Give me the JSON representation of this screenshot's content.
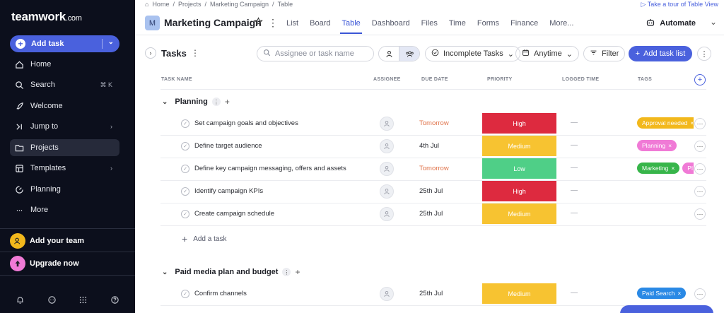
{
  "sidebar": {
    "logo": "teamwork",
    "logo_suffix": ".com",
    "add_task": "Add task",
    "items": [
      {
        "label": "Home",
        "icon": "home-icon"
      },
      {
        "label": "Search",
        "icon": "search-icon",
        "shortcut": "⌘ K"
      },
      {
        "label": "Welcome",
        "icon": "rocket-icon"
      },
      {
        "label": "Jump to",
        "icon": "jump-icon",
        "chevron": "›"
      },
      {
        "label": "Projects",
        "icon": "folder-icon",
        "active": true
      },
      {
        "label": "Templates",
        "icon": "templates-icon",
        "chevron": "›"
      },
      {
        "label": "Planning",
        "icon": "planning-icon"
      },
      {
        "label": "More",
        "icon": "more-icon"
      }
    ],
    "add_team": "Add your team",
    "upgrade": "Upgrade now"
  },
  "header": {
    "breadcrumbs": [
      "Home",
      "Projects",
      "Marketing Campaign",
      "Table"
    ],
    "tour": "Take a tour of Table View",
    "project_initial": "M",
    "project_title": "Marketing Campaign",
    "tabs": [
      "List",
      "Board",
      "Table",
      "Dashboard",
      "Files",
      "Time",
      "Forms",
      "Finance",
      "More..."
    ],
    "active_tab": "Table",
    "automate": "Automate"
  },
  "toolbar": {
    "title": "Tasks",
    "search_placeholder": "Assignee or task name",
    "filter_incomplete": "Incomplete Tasks",
    "filter_time": "Anytime",
    "filter": "Filter",
    "add_task_list": "Add task list"
  },
  "table": {
    "columns": [
      "TASK NAME",
      "ASSIGNEE",
      "DUE DATE",
      "PRIORITY",
      "LOGGED TIME",
      "TAGS"
    ],
    "sections": [
      {
        "name": "Planning",
        "tasks": [
          {
            "name": "Set campaign goals and objectives",
            "due": "Tomorrow",
            "soon": true,
            "priority": "High",
            "logged": "—",
            "tags": [
              {
                "label": "Approval needed",
                "color": "#f2b81c"
              }
            ]
          },
          {
            "name": "Define target audience",
            "due": "4th Jul",
            "soon": false,
            "priority": "Medium",
            "logged": "—",
            "tags": [
              {
                "label": "Planning",
                "color": "#f07ad6"
              }
            ]
          },
          {
            "name": "Define key campaign messaging, offers and assets",
            "due": "Tomorrow",
            "soon": true,
            "priority": "Low",
            "logged": "—",
            "tags": [
              {
                "label": "Marketing",
                "color": "#37b54a"
              },
              {
                "label": "Pl",
                "color": "#f07ad6"
              }
            ]
          },
          {
            "name": "Identify campaign KPIs",
            "due": "25th Jul",
            "soon": false,
            "priority": "High",
            "logged": "—",
            "tags": []
          },
          {
            "name": "Create campaign schedule",
            "due": "25th Jul",
            "soon": false,
            "priority": "Medium",
            "logged": "—",
            "tags": []
          }
        ],
        "add_task": "Add a task"
      },
      {
        "name": "Paid media plan and budget",
        "tasks": [
          {
            "name": "Confirm channels",
            "due": "25th Jul",
            "soon": false,
            "priority": "Medium",
            "logged": "—",
            "tags": [
              {
                "label": "Paid Search",
                "color": "#2a89e5"
              }
            ]
          }
        ]
      }
    ]
  },
  "colors": {
    "High": "#dd2a3f",
    "Medium": "#f7c331",
    "Low": "#4fcf87",
    "accent": "#4a61dd"
  }
}
